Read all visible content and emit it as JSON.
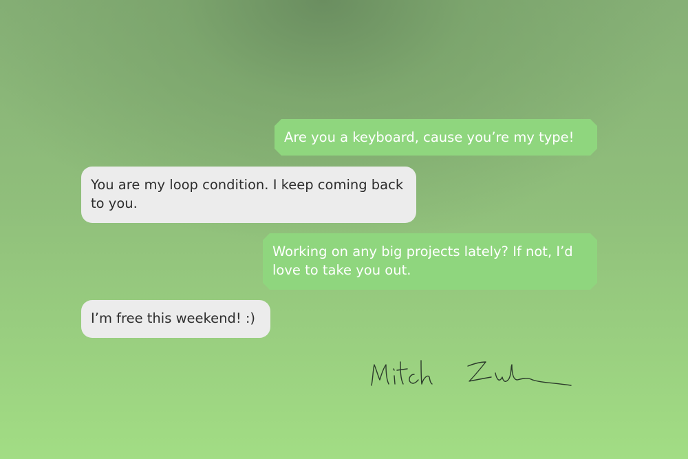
{
  "messages": [
    {
      "direction": "outgoing",
      "text": "Are you a keyboard, cause you’re my type!"
    },
    {
      "direction": "incoming",
      "text": "You are my loop condition. I keep coming back to you."
    },
    {
      "direction": "outgoing",
      "text": "Working on any big projects lately? If not, I’d love to take you out."
    },
    {
      "direction": "incoming",
      "text": "I’m free this weekend! :)"
    }
  ],
  "signature": {
    "text": "Mitch Zuckerman"
  },
  "colors": {
    "outgoing_bubble": "#8fd67e",
    "incoming_bubble": "#ececec",
    "background": "#90bf7b"
  }
}
